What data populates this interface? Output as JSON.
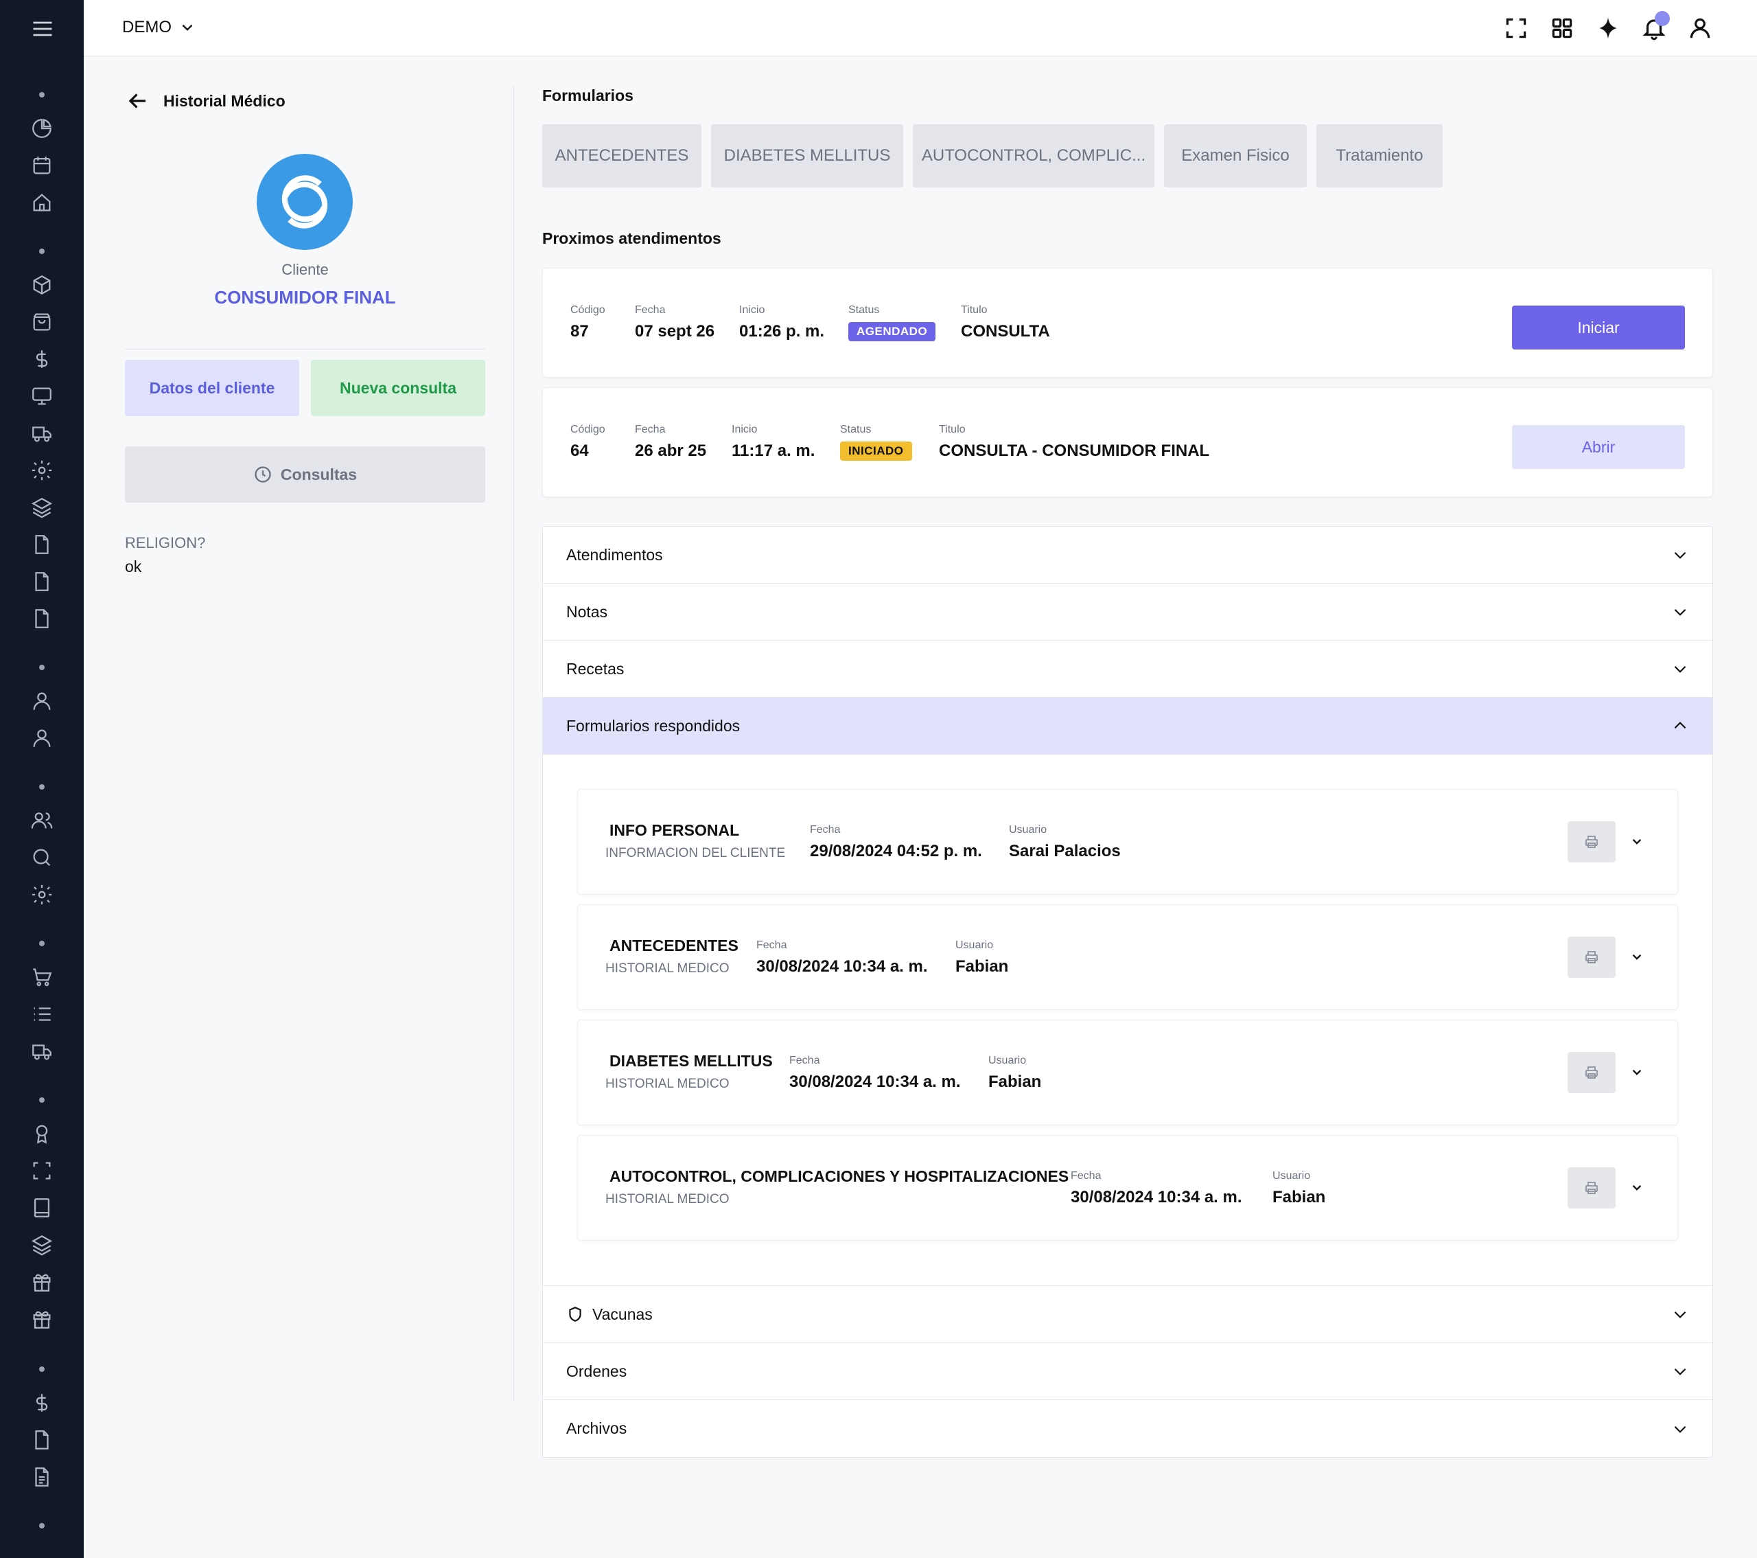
{
  "topbar": {
    "company": "DEMO",
    "icons": [
      "expand-icon",
      "apps-grid-icon",
      "sparkle-icon",
      "bell-icon",
      "user-icon"
    ]
  },
  "sidebar": {
    "icons": [
      "menu-icon",
      "pie-chart-icon",
      "calendar-icon",
      "home-icon",
      "box-icon",
      "shopping-bag-icon",
      "dollar-icon",
      "monitor-icon",
      "truck-icon",
      "gear-icon",
      "layers-icon",
      "file-icon",
      "file-icon",
      "file-icon",
      "user-icon",
      "user-icon",
      "users-icon",
      "search-icon",
      "gear-icon",
      "cart-icon",
      "list-icon",
      "truck-icon",
      "award-icon",
      "scan-icon",
      "book-icon",
      "layers-icon",
      "gift-icon",
      "gift-icon",
      "dollar-icon",
      "file-icon",
      "file-text-icon"
    ]
  },
  "left": {
    "back_title": "Historial Médico",
    "client_label": "Cliente",
    "client_name": "CONSUMIDOR FINAL",
    "btn_datos": "Datos del cliente",
    "btn_nueva": "Nueva consulta",
    "btn_consultas": "Consultas",
    "religion_label": "RELIGION?",
    "religion_value": "ok"
  },
  "main": {
    "formularios_title": "Formularios",
    "form_tabs": [
      "ANTECEDENTES",
      "DIABETES MELLITUS",
      "AUTOCONTROL, COMPLIC...",
      "Examen Fisico",
      "Tratamiento"
    ],
    "proximos_title": "Proximos atendimentos",
    "appointments": [
      {
        "codigo_label": "Código",
        "codigo": "87",
        "fecha_label": "Fecha",
        "fecha": "07 sept 26",
        "inicio_label": "Inicio",
        "inicio": "01:26 p. m.",
        "status_label": "Status",
        "status": "AGENDADO",
        "titulo_label": "Titulo",
        "titulo": "CONSULTA",
        "action": "Iniciar"
      },
      {
        "codigo_label": "Código",
        "codigo": "64",
        "fecha_label": "Fecha",
        "fecha": "26 abr 25",
        "inicio_label": "Inicio",
        "inicio": "11:17 a. m.",
        "status_label": "Status",
        "status": "INICIADO",
        "titulo_label": "Titulo",
        "titulo": "CONSULTA - CONSUMIDOR FINAL",
        "action": "Abrir"
      }
    ],
    "accordion": {
      "atendimentos": "Atendimentos",
      "notas": "Notas",
      "recetas": "Recetas",
      "formularios_respondidos": "Formularios respondidos",
      "vacunas": "Vacunas",
      "ordenes": "Ordenes",
      "archivos": "Archivos"
    },
    "answered_forms": [
      {
        "title": "INFO PERSONAL",
        "subtitle": "INFORMACION DEL CLIENTE",
        "fecha_label": "Fecha",
        "fecha": "29/08/2024 04:52 p. m.",
        "usuario_label": "Usuario",
        "usuario": "Sarai Palacios"
      },
      {
        "title": "ANTECEDENTES",
        "subtitle": "HISTORIAL MEDICO",
        "fecha_label": "Fecha",
        "fecha": "30/08/2024 10:34 a. m.",
        "usuario_label": "Usuario",
        "usuario": "Fabian"
      },
      {
        "title": "DIABETES MELLITUS",
        "subtitle": "HISTORIAL MEDICO",
        "fecha_label": "Fecha",
        "fecha": "30/08/2024 10:34 a. m.",
        "usuario_label": "Usuario",
        "usuario": "Fabian"
      },
      {
        "title": "AUTOCONTROL, COMPLICACIONES Y HOSPITALIZACIONES",
        "subtitle": "HISTORIAL MEDICO",
        "fecha_label": "Fecha",
        "fecha": "30/08/2024 10:34 a. m.",
        "usuario_label": "Usuario",
        "usuario": "Fabian"
      }
    ]
  },
  "colors": {
    "sidebar_bg": "#111827",
    "accent": "#6d63e8",
    "client_name": "#5b5fde",
    "success": "#1f9b47",
    "warning": "#f2be2e"
  }
}
